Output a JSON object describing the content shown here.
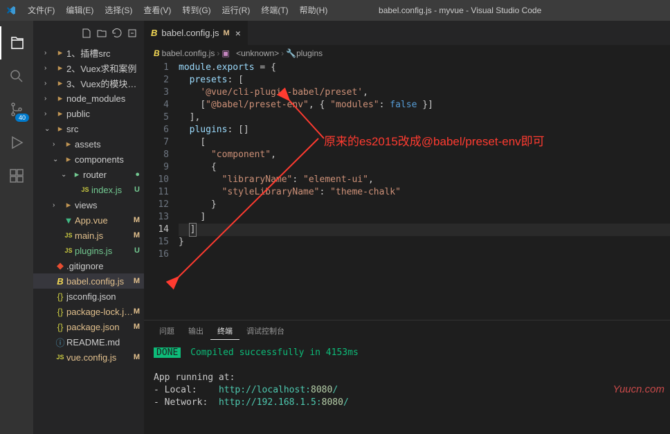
{
  "title": "babel.config.js - myvue - Visual Studio Code",
  "menu": [
    "文件(F)",
    "编辑(E)",
    "选择(S)",
    "查看(V)",
    "转到(G)",
    "运行(R)",
    "终端(T)",
    "帮助(H)"
  ],
  "scm_badge": "40",
  "tree": [
    {
      "ind": 1,
      "chev": "›",
      "type": "folder",
      "label": "1、插槽src"
    },
    {
      "ind": 1,
      "chev": "›",
      "type": "folder",
      "label": "2、Vuex求和案例"
    },
    {
      "ind": 1,
      "chev": "›",
      "type": "folder",
      "label": "3、Vuex的模块…"
    },
    {
      "ind": 1,
      "chev": "›",
      "type": "nm",
      "label": "node_modules"
    },
    {
      "ind": 1,
      "chev": "›",
      "type": "folder",
      "label": "public"
    },
    {
      "ind": 1,
      "chev": "⌄",
      "type": "folder",
      "label": "src"
    },
    {
      "ind": 2,
      "chev": "›",
      "type": "folder",
      "label": "assets"
    },
    {
      "ind": 2,
      "chev": "⌄",
      "type": "folder",
      "label": "components"
    },
    {
      "ind": 3,
      "chev": "⌄",
      "type": "folder-u",
      "label": "router",
      "git": "●",
      "gitClass": "u"
    },
    {
      "ind": 4,
      "chev": "",
      "type": "js",
      "label": "index.js",
      "git": "U",
      "gitClass": "u",
      "cls": "untracked"
    },
    {
      "ind": 2,
      "chev": "›",
      "type": "folder",
      "label": "views"
    },
    {
      "ind": 2,
      "chev": "",
      "type": "vue",
      "label": "App.vue",
      "git": "M",
      "gitClass": "m",
      "cls": "modified"
    },
    {
      "ind": 2,
      "chev": "",
      "type": "js",
      "label": "main.js",
      "git": "M",
      "gitClass": "m",
      "cls": "modified"
    },
    {
      "ind": 2,
      "chev": "",
      "type": "js",
      "label": "plugins.js",
      "git": "U",
      "gitClass": "u",
      "cls": "untracked"
    },
    {
      "ind": 1,
      "chev": "",
      "type": "git",
      "label": ".gitignore"
    },
    {
      "ind": 1,
      "chev": "",
      "type": "babel",
      "label": "babel.config.js",
      "git": "M",
      "gitClass": "m",
      "cls": "modified selected"
    },
    {
      "ind": 1,
      "chev": "",
      "type": "json",
      "label": "jsconfig.json"
    },
    {
      "ind": 1,
      "chev": "",
      "type": "json",
      "label": "package-lock.json",
      "git": "M",
      "gitClass": "m",
      "cls": "modified"
    },
    {
      "ind": 1,
      "chev": "",
      "type": "json",
      "label": "package.json",
      "git": "M",
      "gitClass": "m",
      "cls": "modified"
    },
    {
      "ind": 1,
      "chev": "",
      "type": "md",
      "label": "README.md"
    },
    {
      "ind": 1,
      "chev": "",
      "type": "js",
      "label": "vue.config.js",
      "git": "M",
      "gitClass": "m",
      "cls": "modified"
    }
  ],
  "tab": {
    "label": "babel.config.js",
    "git": "M"
  },
  "breadcrumb": {
    "file": "babel.config.js",
    "seg1": "<unknown>",
    "seg2": "plugins"
  },
  "code": [
    {
      "n": 1,
      "html": "<span class='k1'>module</span><span class='k4'>.</span><span class='k1'>exports</span><span class='k4'> = {</span>"
    },
    {
      "n": 2,
      "html": "  <span class='k1'>presets</span><span class='k4'>: [</span>"
    },
    {
      "n": 3,
      "html": "    <span class='k2'>'@vue/cli-plugin-babel/preset'</span><span class='k4'>,</span>"
    },
    {
      "n": 4,
      "html": "    <span class='k4'>[</span><span class='k2'>\"@babel/preset-env\"</span><span class='k4'>, { </span><span class='k2'>\"modules\"</span><span class='k4'>: </span><span class='k3'>false</span><span class='k4'> }]</span>"
    },
    {
      "n": 5,
      "html": "  <span class='k4'>],</span>"
    },
    {
      "n": 6,
      "html": "  <span class='k1'>plugins</span><span class='k4'>: []</span>"
    },
    {
      "n": 7,
      "html": "    <span class='k4'>[</span>"
    },
    {
      "n": 8,
      "html": "      <span class='k2'>\"component\"</span><span class='k4'>,</span>"
    },
    {
      "n": 9,
      "html": "      <span class='k4'>{</span>"
    },
    {
      "n": 10,
      "html": "        <span class='k2'>\"libraryName\"</span><span class='k4'>: </span><span class='k2'>\"element-ui\"</span><span class='k4'>,</span>"
    },
    {
      "n": 11,
      "html": "        <span class='k2'>\"styleLibraryName\"</span><span class='k4'>: </span><span class='k2'>\"theme-chalk\"</span>"
    },
    {
      "n": 12,
      "html": "      <span class='k4'>}</span>"
    },
    {
      "n": 13,
      "html": "    <span class='k4'>]</span>"
    },
    {
      "n": 14,
      "html": "  <span class='k4 cursor-box'>]</span>",
      "active": true
    },
    {
      "n": 15,
      "html": "<span class='k4'>}</span>"
    },
    {
      "n": 16,
      "html": ""
    }
  ],
  "panel_tabs": [
    "问题",
    "输出",
    "终端",
    "调试控制台"
  ],
  "panel_active": 2,
  "terminal": {
    "done": "DONE",
    "compile": "Compiled successfully in 4153ms",
    "running": "App running at:",
    "local_k": "- Local:",
    "local_v": "http://localhost:",
    "local_port": "8080",
    "nw_k": "- Network:",
    "nw_v": "http://192.168.1.5:",
    "nw_port": "8080"
  },
  "annotations": {
    "top": "原来的es2015改成@babel/preset-env即可"
  },
  "watermark": "Yuucn.com"
}
